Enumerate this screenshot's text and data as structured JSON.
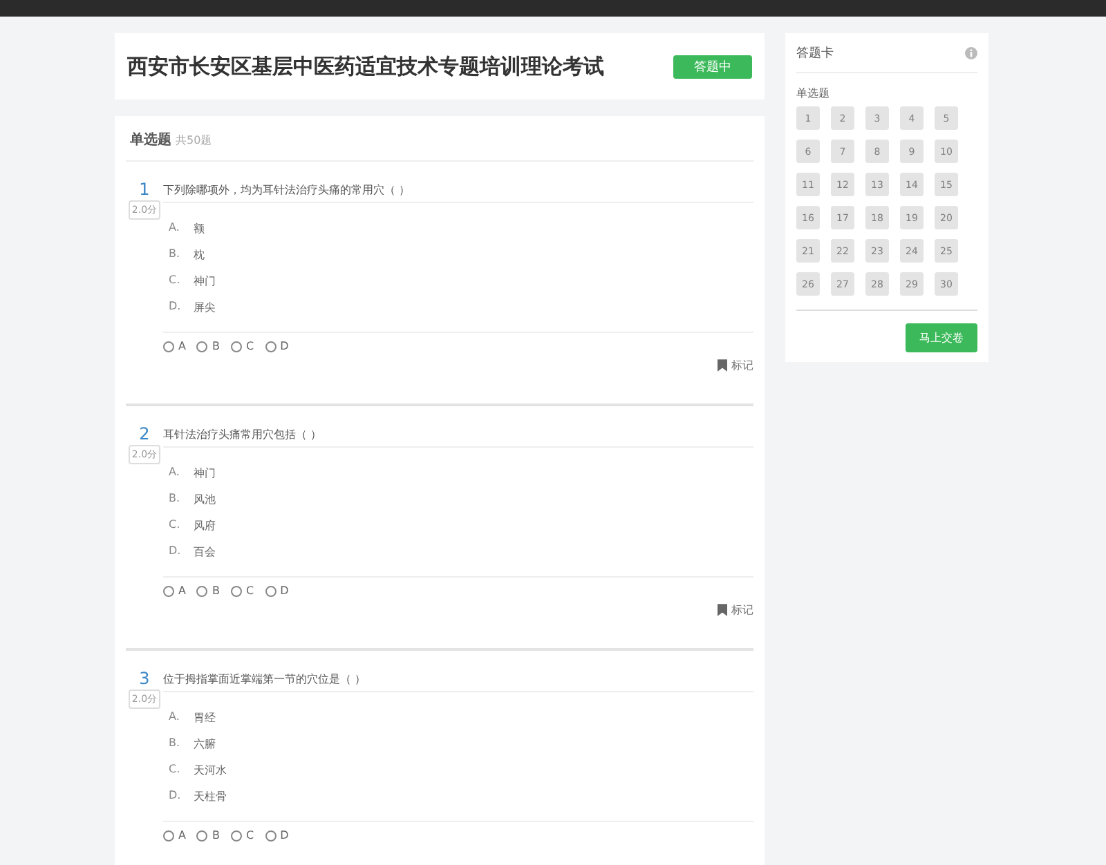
{
  "exam": {
    "title": "西安市长安区基层中医药适宜技术专题培训理论考试",
    "status": "答题中"
  },
  "section": {
    "title": "单选题",
    "count": "共50题"
  },
  "questions": [
    {
      "number": "1",
      "score": "2.0分",
      "text": "下列除哪项外，均为耳针法治疗头痛的常用穴（ ）",
      "options": [
        {
          "letter": "A.",
          "text": "额"
        },
        {
          "letter": "B.",
          "text": "枕"
        },
        {
          "letter": "C.",
          "text": "神门"
        },
        {
          "letter": "D.",
          "text": "屏尖"
        }
      ],
      "choices": [
        {
          "label": "A",
          "selected": false
        },
        {
          "label": "B",
          "selected": false
        },
        {
          "label": "C",
          "selected": false
        },
        {
          "label": "D",
          "selected": false
        }
      ],
      "mark": "标记"
    },
    {
      "number": "2",
      "score": "2.0分",
      "text": "耳针法治疗头痛常用穴包括（ ）",
      "options": [
        {
          "letter": "A.",
          "text": "神门"
        },
        {
          "letter": "B.",
          "text": "风池"
        },
        {
          "letter": "C.",
          "text": "风府"
        },
        {
          "letter": "D.",
          "text": "百会"
        }
      ],
      "choices": [
        {
          "label": "A",
          "selected": false
        },
        {
          "label": "B",
          "selected": false
        },
        {
          "label": "C",
          "selected": false
        },
        {
          "label": "D",
          "selected": false
        }
      ],
      "mark": "标记"
    },
    {
      "number": "3",
      "score": "2.0分",
      "text": "位于拇指掌面近掌端第一节的穴位是（ ）",
      "options": [
        {
          "letter": "A.",
          "text": "胃经"
        },
        {
          "letter": "B.",
          "text": "六腑"
        },
        {
          "letter": "C.",
          "text": "天河水"
        },
        {
          "letter": "D.",
          "text": "天柱骨"
        }
      ],
      "choices": [
        {
          "label": "A",
          "selected": false
        },
        {
          "label": "B",
          "selected": false
        },
        {
          "label": "C",
          "selected": false
        },
        {
          "label": "D",
          "selected": false
        }
      ]
    }
  ],
  "answer_card": {
    "title": "答题卡",
    "section": "单选题",
    "items": [
      {
        "label": "1",
        "answered": false
      },
      {
        "label": "2",
        "answered": false
      },
      {
        "label": "3",
        "answered": false
      },
      {
        "label": "4",
        "answered": false
      },
      {
        "label": "5",
        "answered": false
      },
      {
        "label": "6",
        "answered": false
      },
      {
        "label": "7",
        "answered": false
      },
      {
        "label": "8",
        "answered": false
      },
      {
        "label": "9",
        "answered": false
      },
      {
        "label": "10",
        "answered": false
      },
      {
        "label": "11",
        "answered": false
      },
      {
        "label": "12",
        "answered": false
      },
      {
        "label": "13",
        "answered": false
      },
      {
        "label": "14",
        "answered": false
      },
      {
        "label": "15",
        "answered": false
      },
      {
        "label": "16",
        "answered": false
      },
      {
        "label": "17",
        "answered": false
      },
      {
        "label": "18",
        "answered": false
      },
      {
        "label": "19",
        "answered": false
      },
      {
        "label": "20",
        "answered": false
      },
      {
        "label": "21",
        "answered": false
      },
      {
        "label": "22",
        "answered": false
      },
      {
        "label": "23",
        "answered": false
      },
      {
        "label": "24",
        "answered": false
      },
      {
        "label": "25",
        "answered": false
      },
      {
        "label": "26",
        "answered": false
      },
      {
        "label": "27",
        "answered": false
      },
      {
        "label": "28",
        "answered": false
      },
      {
        "label": "29",
        "answered": false
      },
      {
        "label": "30",
        "answered": false
      }
    ],
    "submit": "马上交卷"
  }
}
